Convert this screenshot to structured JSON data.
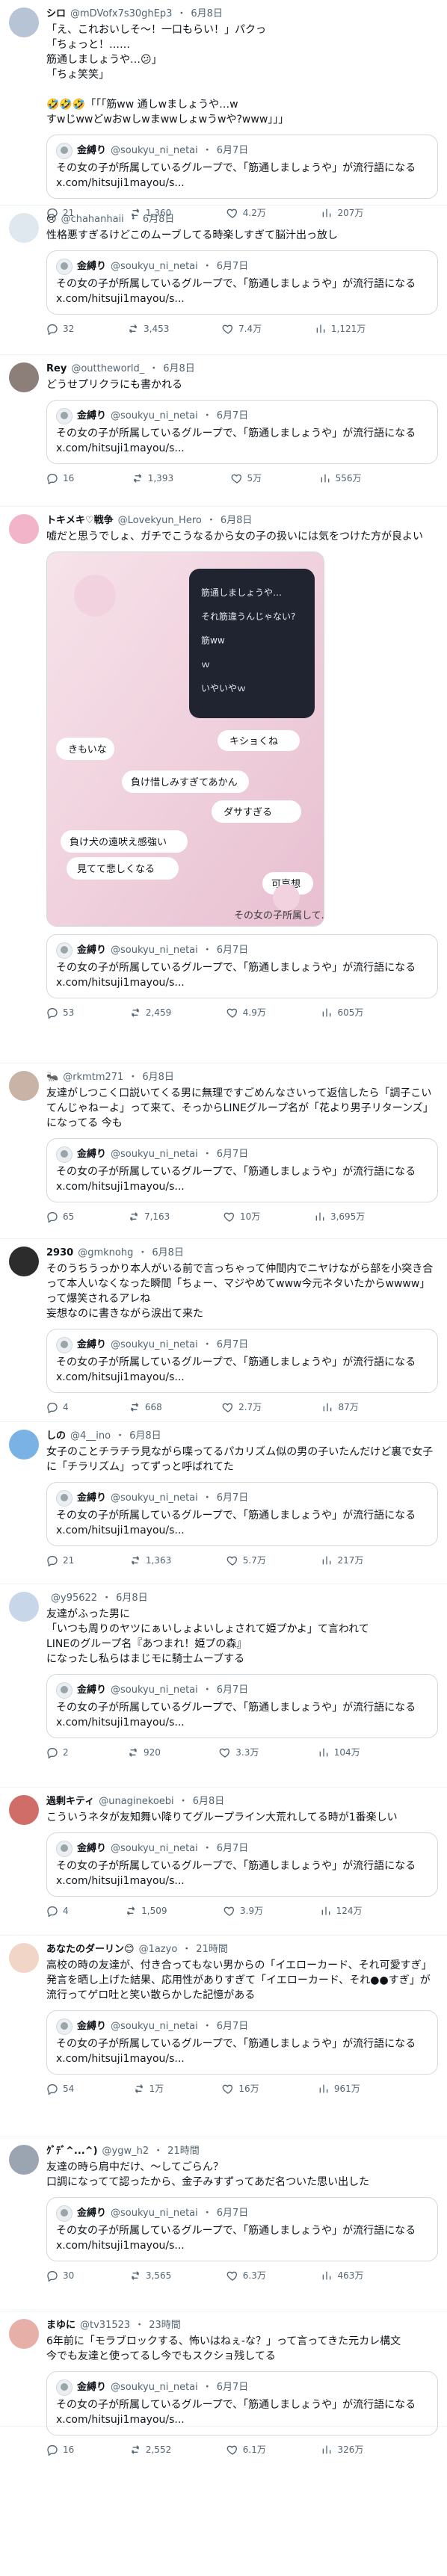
{
  "tweets": [
    {
      "name": "シロ",
      "handle": "@mDVofx7s30ghEp3",
      "dot": "・",
      "time": "6月8日",
      "text": "「え、これおいしそ〜！一口もらい！」パクっ\n「ちょっと！……\n筋通しましょうや…😕」\n「ちょ笑笑」\n\n🤣🤣🤣「「「筋ww 通しwましょうや…w\nすwじwwどwおwしwまwwしょwうwや?www」」」",
      "quote": {
        "name": "金縛り",
        "handle": "@soukyu_ni_netai",
        "time": "6月7日",
        "text": "その女の子が所属しているグループで、「筋通しましょうや」が流行語になる x.com/hitsuji1mayou/s..."
      },
      "stats": {
        "reply": "21",
        "retweet": "1,360",
        "like": "4.2万",
        "view": "207万"
      }
    },
    {
      "name": "😢",
      "handle": "@chahanhaii",
      "dot": "・",
      "time": "6月8日",
      "text": "性格悪すぎるけどこのムーブしてる時楽しすぎて脳汁出っ放し",
      "quote": {
        "name": "金縛り",
        "handle": "@soukyu_ni_netai",
        "time": "6月7日",
        "text": "その女の子が所属しているグループで、「筋通しましょうや」が流行語になる x.com/hitsuji1mayou/s..."
      },
      "stats": {
        "reply": "32",
        "retweet": "3,453",
        "like": "7.4万",
        "view": "1,121万"
      }
    },
    {
      "name": "Rey",
      "handle": "@outtheworld_",
      "dot": "・",
      "time": "6月8日",
      "text": "どうせプリクラにも書かれる",
      "quote": {
        "name": "金縛り",
        "handle": "@soukyu_ni_netai",
        "time": "6月7日",
        "text": "その女の子が所属しているグループで、「筋通しましょうや」が流行語になる x.com/hitsuji1mayou/s..."
      },
      "stats": {
        "reply": "16",
        "retweet": "1,393",
        "like": "5万",
        "view": "556万"
      }
    },
    {
      "name": "トキメキ♡戦争",
      "handle": "@Lovekyun_Hero",
      "dot": "・",
      "time": "6月8日",
      "text": "嘘だと思うでしょ、ガチでこうなるから女の子の扱いには気をつけた方が良よい",
      "image": {
        "chat": [
          "きもいな",
          "負け惜しみすぎてあかん",
          "ダサすぎる",
          "負け犬の遠吠え感強い",
          "見てて悲しくなる",
          "キショくね",
          "可哀想",
          "その女の子所属して..."
        ],
        "dark_lines": [
          "筋通しましょうや…",
          "それ筋違うんじゃない?",
          "筋ww",
          "ｗ",
          "いやいやｗ"
        ]
      },
      "quote": {
        "name": "金縛り",
        "handle": "@soukyu_ni_netai",
        "time": "6月7日",
        "text": "その女の子が所属しているグループで、「筋通しましょうや」が流行語になる x.com/hitsuji1mayou/s..."
      },
      "stats": {
        "reply": "53",
        "retweet": "2,459",
        "like": "4.9万",
        "view": "605万"
      }
    },
    {
      "name": "🐜",
      "handle": "@rkmtm271",
      "dot": "・",
      "time": "6月8日",
      "text": "友達がしつこく口説いてくる男に無理ですごめんなさいって返信したら「調子こいてんじゃねーよ」って来て、そっからLINEグループ名が「花より男子リターンズ」になってる 今も",
      "quote": {
        "name": "金縛り",
        "handle": "@soukyu_ni_netai",
        "time": "6月7日",
        "text": "その女の子が所属しているグループで、「筋通しましょうや」が流行語になる x.com/hitsuji1mayou/s..."
      },
      "stats": {
        "reply": "65",
        "retweet": "7,163",
        "like": "10万",
        "view": "3,695万"
      }
    },
    {
      "name": "2930",
      "handle": "@gmknohg",
      "dot": "・",
      "time": "6月8日",
      "text": "そのうちうっかり本人がいる前で言っちゃって仲間内でニヤけながら部を小突き合って本人いなくなった瞬間「ちょー、マジやめてwww今元ネタいたからwwww」って爆笑されるアレね\n妄想なのに書きながら涙出て来た",
      "quote": {
        "name": "金縛り",
        "handle": "@soukyu_ni_netai",
        "time": "6月7日",
        "text": "その女の子が所属しているグループで、「筋通しましょうや」が流行語になる x.com/hitsuji1mayou/s..."
      },
      "stats": {
        "reply": "4",
        "retweet": "668",
        "like": "2.7万",
        "view": "87万"
      }
    },
    {
      "name": "しの",
      "handle": "@4__ino",
      "dot": "・",
      "time": "6月8日",
      "text": "女子のことチラチラ見ながら喋ってるパカリズム似の男の子いたんだけど裏で女子に「チラリズム」ってずっと呼ばれてた",
      "quote": {
        "name": "金縛り",
        "handle": "@soukyu_ni_netai",
        "time": "6月7日",
        "text": "その女の子が所属しているグループで、「筋通しましょうや」が流行語になる x.com/hitsuji1mayou/s..."
      },
      "stats": {
        "reply": "21",
        "retweet": "1,363",
        "like": "5.7万",
        "view": "217万"
      }
    },
    {
      "name": "",
      "handle": "@y95622",
      "dot": "・",
      "time": "6月8日",
      "text": "友達がふった男に\n「いつも周りのヤツにぁいしょよいしょされて姫プかよ」て言われて\nLINEのグループ名『あつまれ！姫プの森』\nになったし私らはまじモに騎士ムーブする",
      "quote": {
        "name": "金縛り",
        "handle": "@soukyu_ni_netai",
        "time": "6月7日",
        "text": "その女の子が所属しているグループで、「筋通しましょうや」が流行語になる x.com/hitsuji1mayou/s..."
      },
      "stats": {
        "reply": "2",
        "retweet": "920",
        "like": "3.3万",
        "view": "104万"
      }
    },
    {
      "name": "過剰キティ",
      "handle": "@unaginekoebi",
      "dot": "・",
      "time": "6月8日",
      "text": "こういうネタが友知舞い降りてグループライン大荒れしてる時が1番楽しい",
      "quote": {
        "name": "金縛り",
        "handle": "@soukyu_ni_netai",
        "time": "6月7日",
        "text": "その女の子が所属しているグループで、「筋通しましょうや」が流行語になる x.com/hitsuji1mayou/s..."
      },
      "stats": {
        "reply": "4",
        "retweet": "1,509",
        "like": "3.9万",
        "view": "124万"
      }
    },
    {
      "name": "あなたのダーリン😊",
      "handle": "@1azyo",
      "dot": "・",
      "time": "21時間",
      "text": "高校の時の友達が、付き合ってもない男からの「イエローカード、それ可愛すぎ」発言を晒し上げた結果、応用性がありすぎて「イエローカード、それ●●すぎ」が流行ってゲロ吐と笑い散らかした記憶がある",
      "quote": {
        "name": "金縛り",
        "handle": "@soukyu_ni_netai",
        "time": "6月7日",
        "text": "その女の子が所属しているグループで、「筋通しましょうや」が流行語になる x.com/hitsuji1mayou/s..."
      },
      "stats": {
        "reply": "54",
        "retweet": "1万",
        "like": "16万",
        "view": "961万"
      }
    },
    {
      "name": "ｸﾞﾃﾞ^...^)",
      "handle": "@ygw_h2",
      "dot": "・",
      "time": "21時間",
      "text": "友達の時ら肩中だけ、〜してごらん？\n口調になってて認ったから、金子みすずってあだ名ついた思い出した",
      "quote": {
        "name": "金縛り",
        "handle": "@soukyu_ni_netai",
        "time": "6月7日",
        "text": "その女の子が所属しているグループで、「筋通しましょうや」が流行語になる x.com/hitsuji1mayou/s..."
      },
      "stats": {
        "reply": "30",
        "retweet": "3,565",
        "like": "6.3万",
        "view": "463万"
      }
    },
    {
      "name": "まゆに",
      "handle": "@tv31523",
      "dot": "・",
      "time": "23時間",
      "text": "6年前に「モラブロックする、怖いはねぇ-な？」って言ってきた元カレ構文\n今でも友達と使ってるし今でもスクショ残してる",
      "quote": {
        "name": "金縛り",
        "handle": "@soukyu_ni_netai",
        "time": "6月7日",
        "text": "その女の子が所属しているグループで、「筋通しましょうや」が流行語になる x.com/hitsuji1mayou/s..."
      },
      "stats": {
        "reply": "16",
        "retweet": "2,552",
        "like": "6.1万",
        "view": "326万"
      }
    }
  ],
  "colors": {
    "meta": "#536471",
    "border": "#cfd9de",
    "divider": "#eff3f4",
    "bubble_pink": "#f6dbe6",
    "dark_chat": "#1f2430"
  }
}
